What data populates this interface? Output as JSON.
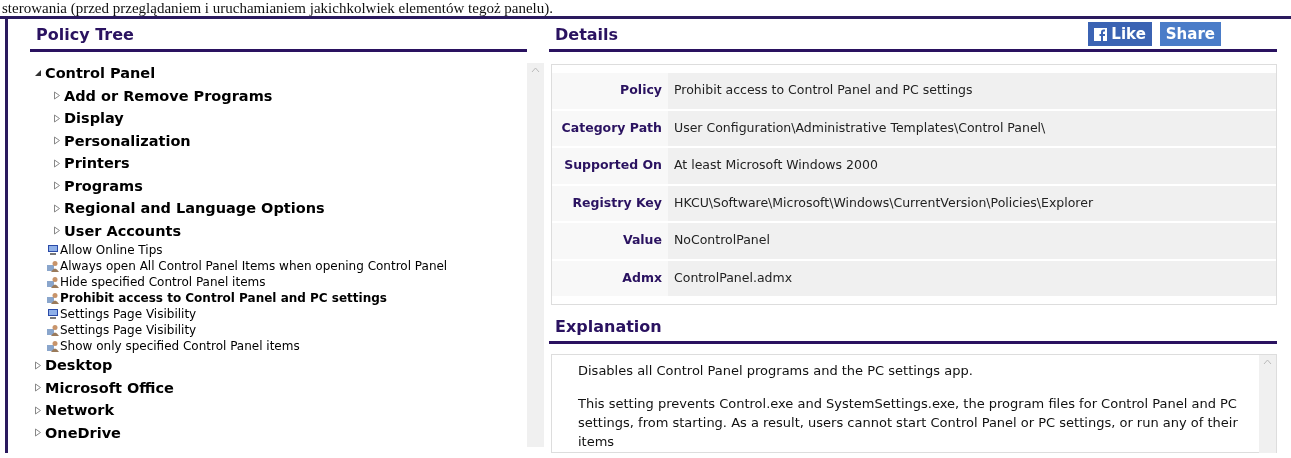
{
  "top_text": "sterowania (przed przeglądaniem i uruchamianiem jakichkolwiek elementów tegoż panelu).",
  "policy_tree": {
    "title": "Policy Tree",
    "items": [
      {
        "label": "Control Panel",
        "kind": "category",
        "expanded": true,
        "children": [
          {
            "label": "Add or Remove Programs",
            "kind": "category",
            "expanded": false
          },
          {
            "label": "Display",
            "kind": "category",
            "expanded": false
          },
          {
            "label": "Personalization",
            "kind": "category",
            "expanded": false
          },
          {
            "label": "Printers",
            "kind": "category",
            "expanded": false
          },
          {
            "label": "Programs",
            "kind": "category",
            "expanded": false
          },
          {
            "label": "Regional and Language Options",
            "kind": "category",
            "expanded": false
          },
          {
            "label": "User Accounts",
            "kind": "category",
            "expanded": false
          },
          {
            "label": "Allow Online Tips",
            "kind": "machine_policy",
            "selected": false
          },
          {
            "label": "Always open All Control Panel Items when opening Control Panel",
            "kind": "user_policy",
            "selected": false
          },
          {
            "label": "Hide specified Control Panel items",
            "kind": "user_policy",
            "selected": false
          },
          {
            "label": "Prohibit access to Control Panel and PC settings",
            "kind": "user_policy",
            "selected": true
          },
          {
            "label": "Settings Page Visibility",
            "kind": "machine_policy",
            "selected": false
          },
          {
            "label": "Settings Page Visibility",
            "kind": "user_policy",
            "selected": false
          },
          {
            "label": "Show only specified Control Panel items",
            "kind": "user_policy",
            "selected": false
          }
        ]
      },
      {
        "label": "Desktop",
        "kind": "category",
        "expanded": false
      },
      {
        "label": "Microsoft Office",
        "kind": "category",
        "expanded": false
      },
      {
        "label": "Network",
        "kind": "category",
        "expanded": false
      },
      {
        "label": "OneDrive",
        "kind": "category",
        "expanded": false
      }
    ]
  },
  "details": {
    "title": "Details",
    "buttons": [
      {
        "kind": "like",
        "label": "Like"
      },
      {
        "kind": "share",
        "label": "Share"
      }
    ],
    "rows": [
      {
        "label": "Policy",
        "value": "Prohibit access to Control Panel and PC settings"
      },
      {
        "label": "Category Path",
        "value": "User Configuration\\Administrative Templates\\Control Panel\\"
      },
      {
        "label": "Supported On",
        "value": "At least Microsoft Windows 2000"
      },
      {
        "label": "Registry Key",
        "value": "HKCU\\Software\\Microsoft\\Windows\\CurrentVersion\\Policies\\Explorer"
      },
      {
        "label": "Value",
        "value": "NoControlPanel"
      },
      {
        "label": "Admx",
        "value": "ControlPanel.admx"
      }
    ]
  },
  "explanation": {
    "title": "Explanation",
    "paragraphs": [
      "Disables all Control Panel programs and the PC settings app.",
      "This setting prevents Control.exe and SystemSettings.exe, the program files for Control Panel and PC settings, from starting. As a result, users cannot start Control Panel or PC settings, or run any of their items"
    ]
  }
}
